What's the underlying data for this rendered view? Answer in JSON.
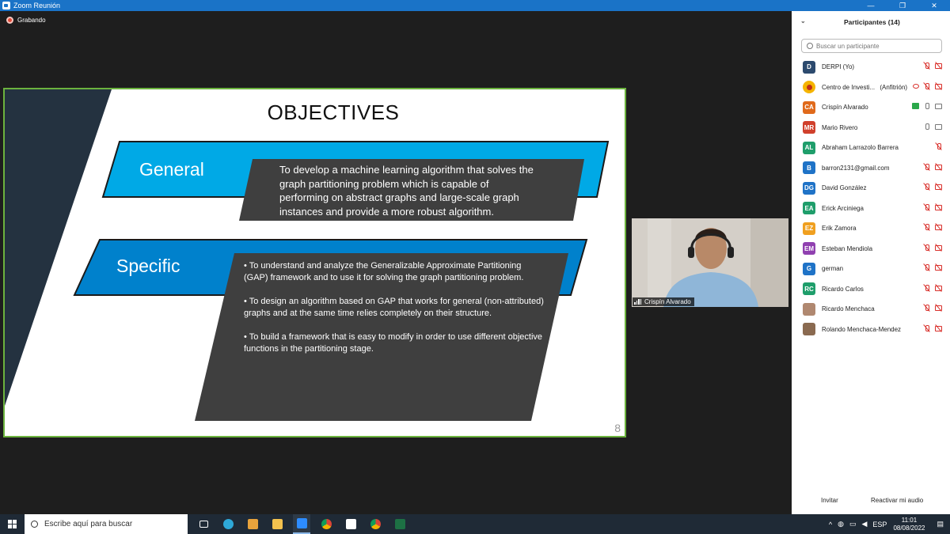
{
  "window": {
    "title": "Zoom Reunión",
    "min": "—",
    "max": "❐",
    "close": "✕"
  },
  "recording": {
    "label": "Grabando"
  },
  "slide": {
    "title": "OBJECTIVES",
    "general_label": "General",
    "general_text": "To develop a machine learning algorithm that solves the graph partitioning problem which is capable of performing on abstract graphs and large-scale graph instances and provide a more robust algorithm.",
    "specific_label": "Specific",
    "specific_points": [
      "• To understand and analyze the Generalizable Approximate Partitioning (GAP) framework and to use it for solving the graph partitioning problem.",
      "• To design an algorithm based on GAP that works for general (non-attributed) graphs and at the same time relies completely on their structure.",
      "• To build a framework that is easy to modify in order to use different objective functions in the partitioning stage."
    ],
    "page_number": "8",
    "colors": {
      "band_light": "#00a9e6",
      "band_dark": "#0081cc",
      "box": "#3f3f3f",
      "border": "#6cb33e"
    }
  },
  "video": {
    "name": "Crispín Alvarado"
  },
  "participants": {
    "title": "Participantes (14)",
    "search_placeholder": "Buscar un participante",
    "list": [
      {
        "initials": "D",
        "name": "DERPI (Yo)",
        "color": "#2c4a6e"
      },
      {
        "initials": "",
        "name": "Centro de Investi...",
        "extra": "(Anfitrión)",
        "color": "#f5b400"
      },
      {
        "initials": "CA",
        "name": "Crispín Alvarado",
        "color": "#e06a1b"
      },
      {
        "initials": "MR",
        "name": "Mario Rivero",
        "color": "#d0402c"
      },
      {
        "initials": "AL",
        "name": "Abraham Larrazolo Barrera",
        "color": "#1f9e6b"
      },
      {
        "initials": "B",
        "name": "barron2131@gmail.com",
        "color": "#1f73c7"
      },
      {
        "initials": "DG",
        "name": "David González",
        "color": "#1f73c7"
      },
      {
        "initials": "EA",
        "name": "Erick Arciniega",
        "color": "#1f9e6b"
      },
      {
        "initials": "EZ",
        "name": "Erik Zamora",
        "color": "#f0a020"
      },
      {
        "initials": "EM",
        "name": "Esteban Mendiola",
        "color": "#9040b0"
      },
      {
        "initials": "G",
        "name": "german",
        "color": "#1f73c7"
      },
      {
        "initials": "RC",
        "name": "Ricardo Carlos",
        "color": "#1f9e6b"
      },
      {
        "initials": "",
        "name": "Ricardo Menchaca",
        "color": "#b08870"
      },
      {
        "initials": "",
        "name": "Rolando Menchaca-Mendez",
        "color": "#8a6a50"
      }
    ],
    "invite": "Invitar",
    "unmute": "Reactivar mi audio"
  },
  "taskbar": {
    "search_placeholder": "Escribe aquí para buscar",
    "lang": "ESP",
    "time": "11:01",
    "date": "08/08/2022"
  }
}
